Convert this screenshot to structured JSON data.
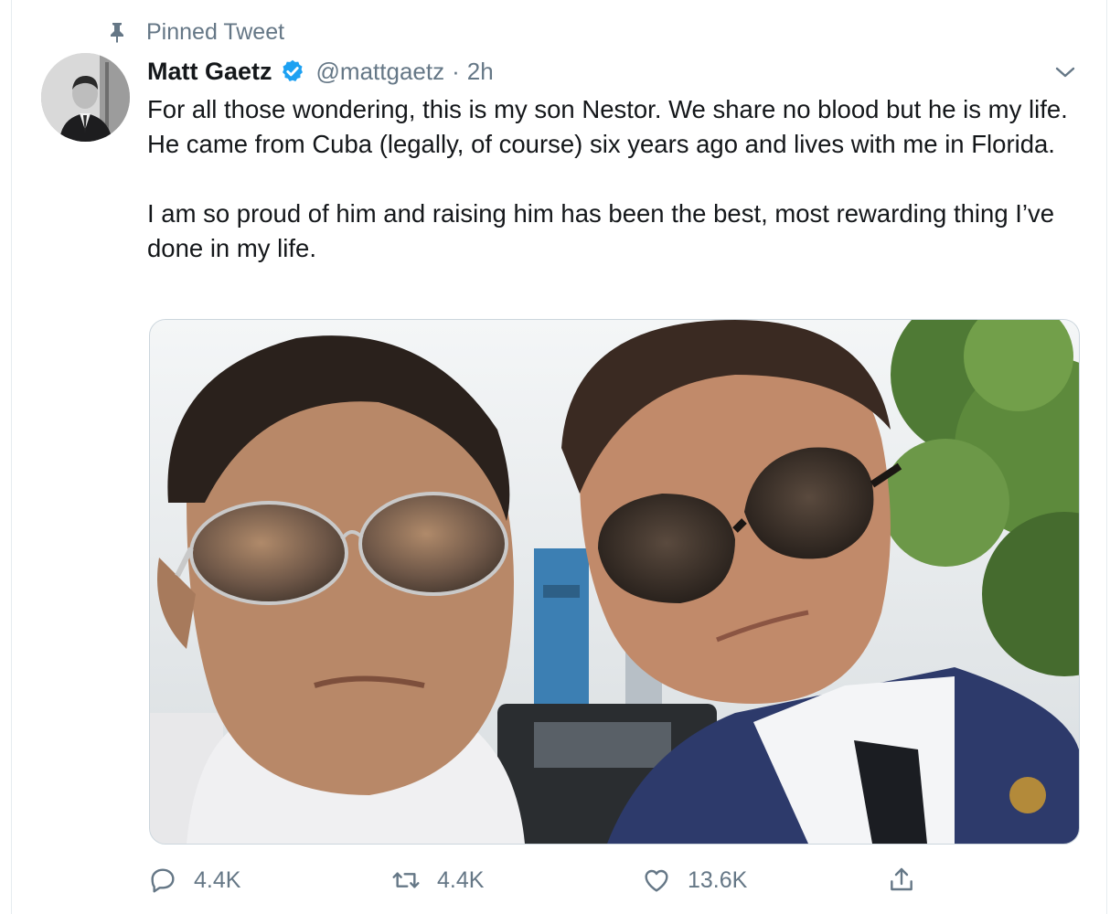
{
  "pinned": {
    "label": "Pinned Tweet",
    "icon": "pin-icon"
  },
  "author": {
    "name": "Matt Gaetz",
    "handle": "@mattgaetz",
    "separator": "·",
    "time": "2h",
    "verified_icon": "verified-badge-icon"
  },
  "tweet": {
    "paragraphs": [
      "For all those wondering, this is my son Nestor.  We share no blood but he is my life. He came from Cuba (legally, of course) six years ago and lives with me in Florida.",
      "I am so proud of him and raising him has been the best, most rewarding thing I’ve done in my life."
    ]
  },
  "actions": {
    "reply": {
      "count": "4.4K",
      "icon": "reply-icon"
    },
    "retweet": {
      "count": "4.4K",
      "icon": "retweet-icon"
    },
    "like": {
      "count": "13.6K",
      "icon": "heart-icon"
    },
    "share": {
      "icon": "share-icon"
    }
  },
  "colors": {
    "text": "#14171a",
    "secondary": "#657786",
    "verified": "#1da1f2",
    "border": "#ccd6dd"
  }
}
